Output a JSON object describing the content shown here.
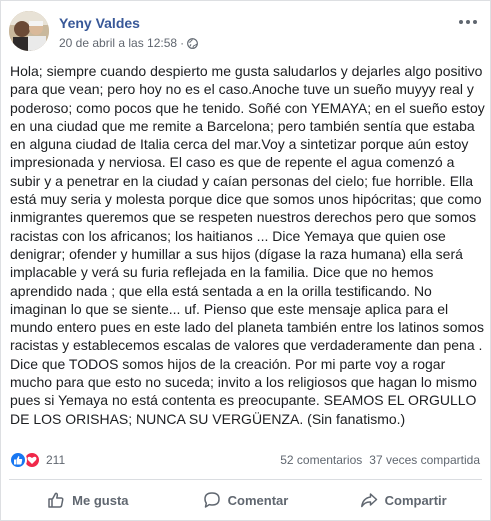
{
  "post": {
    "author": "Yeny Valdes",
    "timestamp": "20 de abril a las 12:58",
    "separator": "·",
    "privacy_icon": "globe-icon",
    "body": "Hola; siempre cuando despierto me gusta saludarlos y dejarles algo positivo para que vean; pero hoy no es el caso.Anoche tuve un sueño muyyy real y poderoso; como pocos que he tenido. Soñé con YEMAYA; en el sueño estoy en una ciudad que me remite a Barcelona; pero también sentía que estaba en alguna ciudad de Italia cerca del mar.Voy a sintetizar porque aún estoy impresionada y nerviosa. El caso es que de repente el agua comenzó a subir y a penetrar en la ciudad y caían personas del cielo; fue horrible. Ella está muy seria y molesta porque dice que somos unos hipócritas; que como inmigrantes queremos que se respeten nuestros derechos pero que somos racistas con los africanos; los haitianos ... Dice Yemaya que quien ose denigrar; ofender y humillar a sus hijos (dígase la raza humana) ella será implacable y verá su furia reflejada en la familia. Dice que no hemos aprendido nada ; que ella está sentada a en la orilla testificando. No imaginan lo que se siente... uf. Pienso que este mensaje aplica para el mundo entero pues en este lado del planeta también entre los latinos somos racistas y establecemos escalas de valores que verdaderamente dan pena . Dice que TODOS somos hijos de la creación. Por mi parte voy a rogar mucho para que esto no suceda; invito a los religiosos que hagan lo mismo pues si Yemaya no está contenta es preocupante. SEAMOS EL ORGULLO DE LOS ORISHAS; NUNCA SU VERGÜENZA. (Sin fanatismo.)"
  },
  "stats": {
    "reaction_count": "211",
    "comments": "52 comentarios",
    "shares": "37 veces compartida"
  },
  "actions": {
    "like": "Me gusta",
    "comment": "Comentar",
    "share": "Compartir"
  },
  "colors": {
    "author_link": "#385898",
    "like_blue": "#1877f2",
    "love_red": "#f0284a",
    "secondary_text": "#606770"
  }
}
